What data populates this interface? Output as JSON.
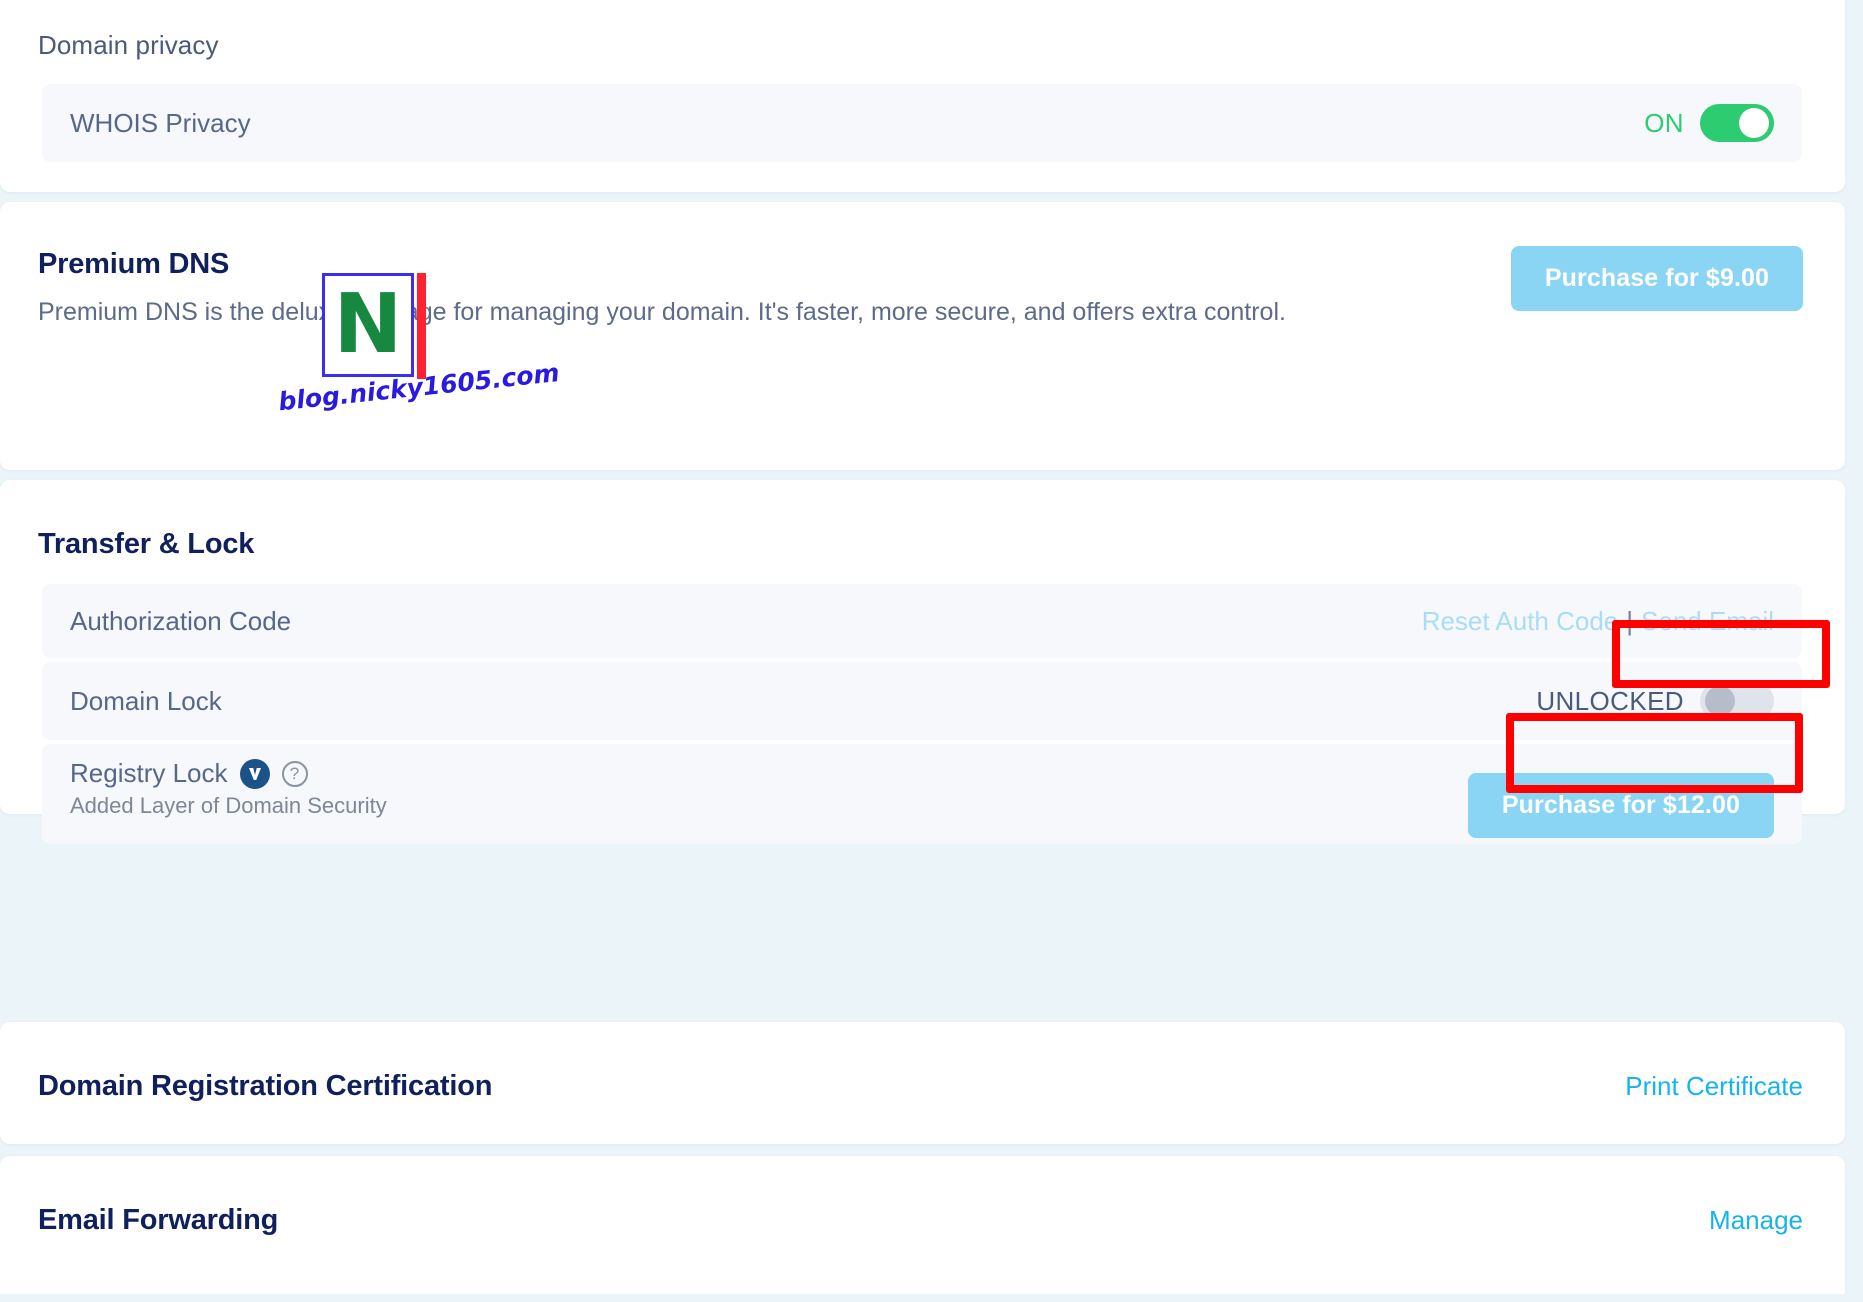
{
  "domain_privacy": {
    "section_label": "Domain privacy",
    "row": {
      "label": "WHOIS Privacy",
      "toggle_state": "ON",
      "toggle_on": true
    }
  },
  "premium_dns": {
    "title": "Premium DNS",
    "description": "Premium DNS is the deluxe package for managing your domain. It's faster, more secure, and offers extra control.",
    "purchase_button": "Purchase for $9.00"
  },
  "transfer_lock": {
    "title": "Transfer & Lock",
    "auth_code": {
      "label": "Authorization Code",
      "reset_link": "Reset Auth Code",
      "separator": "|",
      "send_email_link": "Send Email"
    },
    "domain_lock": {
      "label": "Domain Lock",
      "toggle_state": "UNLOCKED",
      "toggle_on": false
    },
    "registry_lock": {
      "label": "Registry Lock",
      "verisign_badge": "V",
      "help_glyph": "?",
      "subtitle": "Added Layer of Domain Security",
      "purchase_button": "Purchase for $12.00"
    }
  },
  "certification": {
    "title": "Domain Registration Certification",
    "action_link": "Print Certificate"
  },
  "email_forwarding": {
    "title": "Email Forwarding",
    "action_link": "Manage"
  },
  "watermark": {
    "logo_letter": "N",
    "text": "blog.nicky1605.com"
  },
  "colors": {
    "page_background": "#eaf4f9",
    "card_background": "#ffffff",
    "row_background": "#f6f8fb",
    "heading": "#10205c",
    "body_text": "#56678a",
    "toggle_on": "#2ecc71",
    "toggle_off": "#dfe4ec",
    "button_blue": "#8ad5f4",
    "link_faint": "#a9ddf6",
    "link_bright": "#17b3ee",
    "annotation_red": "#ff0000",
    "verisign_navy": "#1b5287"
  }
}
